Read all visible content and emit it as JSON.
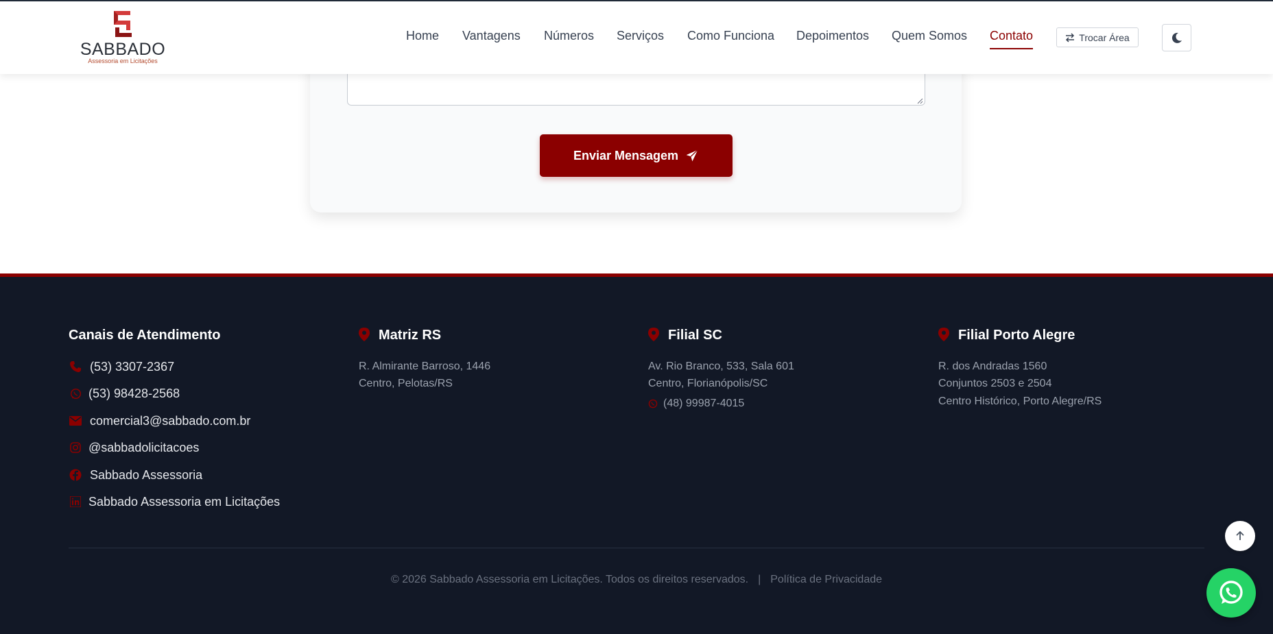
{
  "brand": {
    "name": "SABBADO",
    "tagline": "Assessoria em Licitações",
    "accent_color": "#8b0000",
    "footer_bg": "#121826"
  },
  "nav": {
    "items": [
      {
        "label": "Home",
        "active": false
      },
      {
        "label": "Vantagens",
        "active": false
      },
      {
        "label": "Números",
        "active": false
      },
      {
        "label": "Serviços",
        "active": false
      },
      {
        "label": "Como Funciona",
        "active": false
      },
      {
        "label": "Depoimentos",
        "active": false
      },
      {
        "label": "Quem Somos",
        "active": false
      },
      {
        "label": "Contato",
        "active": true
      }
    ],
    "switch_area_label": "Trocar Área",
    "switch_area_icon": "swap-arrows-icon",
    "theme_toggle_icon": "moon-icon"
  },
  "form": {
    "message_value": "",
    "submit_label": "Enviar Mensagem",
    "submit_icon": "paper-plane-icon"
  },
  "footer": {
    "channels": {
      "title": "Canais de Atendimento",
      "items": [
        {
          "icon": "phone-icon",
          "text": "(53) 3307-2367"
        },
        {
          "icon": "whatsapp-icon",
          "text": "(53) 98428-2568"
        },
        {
          "icon": "envelope-icon",
          "text": "comercial3@sabbado.com.br"
        },
        {
          "icon": "instagram-icon",
          "text": "@sabbadolicitacoes"
        },
        {
          "icon": "facebook-icon",
          "text": "Sabbado Assessoria"
        },
        {
          "icon": "linkedin-icon",
          "text": "Sabbado Assessoria em Licitações"
        }
      ]
    },
    "matriz": {
      "title": "Matriz RS",
      "lines": [
        "R. Almirante Barroso, 1446",
        "Centro, Pelotas/RS"
      ]
    },
    "filial_sc": {
      "title": "Filial SC",
      "lines": [
        "Av. Rio Branco, 533, Sala 601",
        "Centro, Florianópolis/SC"
      ],
      "phone": "(48) 99987-4015"
    },
    "filial_poa": {
      "title": "Filial Porto Alegre",
      "lines": [
        "R. dos Andradas 1560",
        "Conjuntos 2503 e 2504",
        "Centro Histórico, Porto Alegre/RS"
      ]
    },
    "copyright": "© 2026 Sabbado Assessoria em Licitações. Todos os direitos reservados.",
    "separator": "|",
    "privacy_label": "Política de Privacidade"
  },
  "floating": {
    "scroll_top_icon": "arrow-up-icon",
    "whatsapp_icon": "whatsapp-icon"
  }
}
